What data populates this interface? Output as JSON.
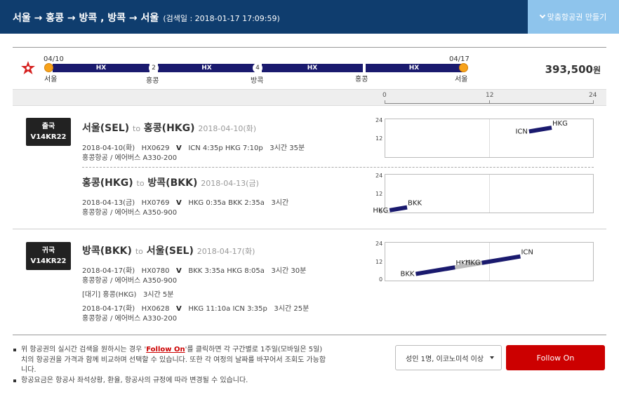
{
  "header": {
    "route": "서울 → 홍콩 → 방콕 , 방콕 → 서울",
    "search_date": "(검색일 : 2018-01-17 17:09:59)",
    "custom_button": "맞춤항공권 만들기"
  },
  "summary": {
    "start_date": "04/10",
    "end_date": "04/17",
    "carrier_code": "HX",
    "nodes": [
      "2",
      "4"
    ],
    "cities": [
      "서울",
      "홍콩",
      "방콕",
      "홍콩",
      "서울"
    ],
    "price": "393,500",
    "currency": "원"
  },
  "timeline_axis": {
    "ticks": [
      "0",
      "12",
      "24"
    ]
  },
  "chart_axis": {
    "ticks": [
      "24",
      "12",
      "0"
    ]
  },
  "chart_data": [
    {
      "type": "line",
      "x_unit": "hour",
      "ylim": [
        0,
        24
      ],
      "segments": [
        {
          "from": "ICN",
          "to": "HKG",
          "dep": 16.58,
          "arr": 19.17,
          "color": "#1a1a6e"
        }
      ]
    },
    {
      "type": "line",
      "x_unit": "hour",
      "ylim": [
        0,
        24
      ],
      "segments": [
        {
          "from": "HKG",
          "to": "BKK",
          "dep": 0.58,
          "arr": 2.58,
          "color": "#1a1a6e"
        }
      ]
    },
    {
      "type": "line",
      "x_unit": "hour",
      "ylim": [
        0,
        24
      ],
      "segments": [
        {
          "from": "BKK",
          "to": "HKG",
          "dep": 3.58,
          "arr": 8.08,
          "color": "#1a1a6e"
        },
        {
          "from": "HKG",
          "to": "HKG",
          "dep": 8.08,
          "arr": 11.17,
          "color": "#bbbbbb"
        },
        {
          "from": "HKG",
          "to": "ICN",
          "dep": 11.17,
          "arr": 15.58,
          "color": "#1a1a6e"
        }
      ]
    }
  ],
  "outbound": {
    "badge_type": "출국",
    "badge_code": "V14KR22",
    "segments": [
      {
        "from": "서울(SEL)",
        "to_word": "to",
        "to": "홍콩(HKG)",
        "date": "2018-04-10(화)",
        "detail_date": "2018-04-10(화)",
        "flight": "HX0629",
        "class": "V",
        "times": "ICN 4:35p HKG 7:10p",
        "duration": "3시간 35분",
        "airline": "홍콩항공 / 에어버스 A330-200"
      },
      {
        "from": "홍콩(HKG)",
        "to_word": "to",
        "to": "방콕(BKK)",
        "date": "2018-04-13(금)",
        "detail_date": "2018-04-13(금)",
        "flight": "HX0769",
        "class": "V",
        "times": "HKG 0:35a BKK 2:35a",
        "duration": "3시간",
        "airline": "홍콩항공 / 에어버스 A350-900"
      }
    ]
  },
  "inbound": {
    "badge_type": "귀국",
    "badge_code": "V14KR22",
    "from": "방콕(BKK)",
    "to_word": "to",
    "to": "서울(SEL)",
    "date": "2018-04-17(화)",
    "leg1": {
      "detail_date": "2018-04-17(화)",
      "flight": "HX0780",
      "class": "V",
      "times": "BKK 3:35a HKG 8:05a",
      "duration": "3시간 30분",
      "airline": "홍콩항공 / 에어버스 A350-900"
    },
    "wait": "[대기] 홍콩(HKG)   3시간 5분",
    "leg2": {
      "detail_date": "2018-04-17(화)",
      "flight": "HX0628",
      "class": "V",
      "times": "HKG 11:10a ICN 3:35p",
      "duration": "3시간 25분",
      "airline": "홍콩항공 / 에어버스 A330-200"
    }
  },
  "notes": {
    "n1_before": "위 항공권의 실시간 검색을 원하시는 경우 '",
    "n1_link": "Follow On",
    "n1_after": "'를 클릭하면 각 구간별로 1주일(모바일은 5일)치의 항공권을 가격과 함께 비교하며 선택할 수 있습니다. 또한 각 여정의 날짜를 바꾸어서 조회도 가능합니다.",
    "n2": "항공요금은 항공사 좌석상황, 환율, 항공사의 규정에 따라 변경될 수 있습니다."
  },
  "passenger_select": "성인 1명, 이코노미석 이상",
  "follow_on_button": "Follow On",
  "colors": {
    "header_bg": "#0f3d6e",
    "bar": "#1a1a6e",
    "accent_red": "#cc0000",
    "dot": "#f7a21b"
  }
}
